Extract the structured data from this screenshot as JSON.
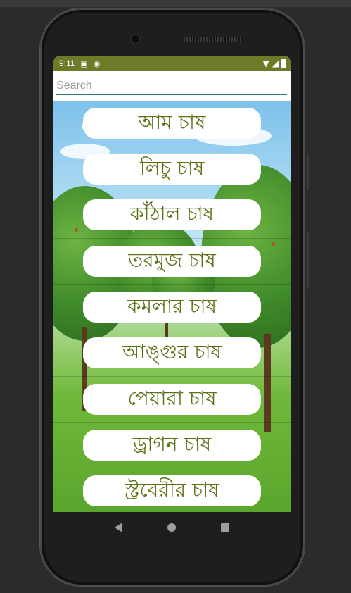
{
  "status_bar": {
    "time": "9:11",
    "icons": [
      "notification-a-icon",
      "notification-circle-icon",
      "wifi-icon",
      "signal-icon",
      "battery-icon"
    ]
  },
  "search": {
    "placeholder": "Search",
    "value": ""
  },
  "list": {
    "items": [
      {
        "label": "আম চাষ"
      },
      {
        "label": "লিচু চাষ"
      },
      {
        "label": "কাঁঠাল চাষ"
      },
      {
        "label": "তরমুজ চাষ"
      },
      {
        "label": "কমলার চাষ"
      },
      {
        "label": "আঙ্গুর চাষ"
      },
      {
        "label": "পেয়ারা চাষ"
      },
      {
        "label": "ড্রাগন চাষ"
      },
      {
        "label": "স্ট্রবেরীর চাষ"
      }
    ]
  },
  "colors": {
    "status_bar": "#6d7a27",
    "item_text": "#5b7316",
    "search_underline": "#2b7a74"
  },
  "nav_bar": {
    "icons": [
      "back-icon",
      "home-icon",
      "recents-icon"
    ]
  }
}
